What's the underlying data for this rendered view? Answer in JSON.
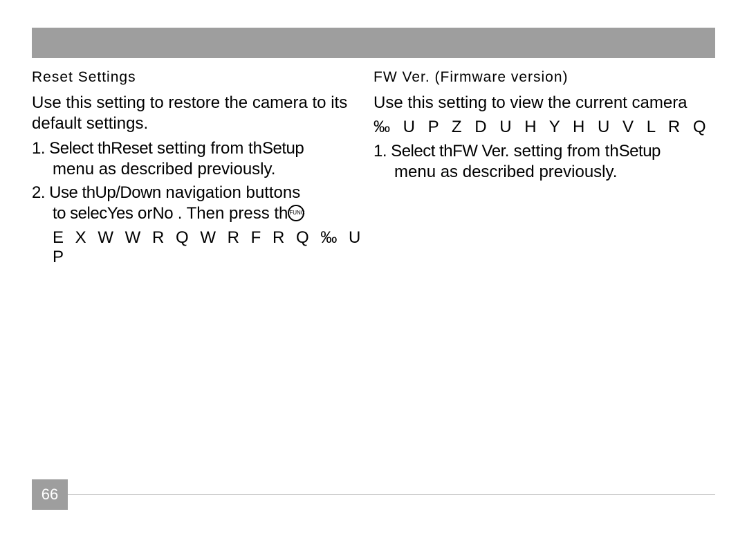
{
  "page_number": "66",
  "left": {
    "heading": "Reset Settings",
    "intro": "Use this setting to restore the camera to its default settings.",
    "step1_a": "1. Select th",
    "step1_b": "Reset",
    "step1_c": "    setting from th",
    "step1_d": "Setup",
    "step1_line2": "menu as described previously.",
    "step2_a": "2. Use th",
    "step2_b": "Up/Down",
    "step2_c": "    navigation buttons",
    "step2_line2a": "to selec",
    "step2_line2b": "Yes",
    "step2_line2c": "   or",
    "step2_line2d": "No",
    "step2_line2e": " . Then press th",
    "step2_cipher": "E X W W R Q  W R  F R Q ‰ U P"
  },
  "right": {
    "heading": "FW Ver. (Firmware version)",
    "intro": "Use this setting to view the current camera",
    "cipher": "‰ U P Z D U H  Y H U V L R Q",
    "step1_a": "1. Select th",
    "step1_b": "FW Ver.",
    "step1_c": "    setting from th",
    "step1_d": "Setup",
    "step1_line2": "menu as described previously."
  },
  "icon_label": "FUNC"
}
